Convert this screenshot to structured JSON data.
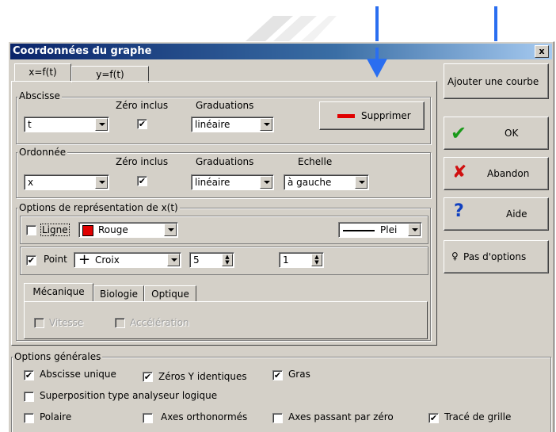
{
  "window": {
    "title": "Coordonnées du graphe",
    "close": "x"
  },
  "tabs": [
    "x=f(t)",
    "y=f(t)"
  ],
  "abscisse": {
    "label": "Abscisse",
    "zero_label": "Zéro inclus",
    "grad_label": "Graduations",
    "variable": "t",
    "graduation": "linéaire",
    "zero_checked": "✔"
  },
  "ordonnee": {
    "label": "Ordonnée",
    "zero_label": "Zéro inclus",
    "grad_label": "Graduations",
    "scale_label": "Echelle",
    "variable": "x",
    "graduation": "linéaire",
    "scale": "à gauche",
    "zero_checked": "✔"
  },
  "supprimer": {
    "label": "Supprimer",
    "accent": "#e00000"
  },
  "options_repr": {
    "label": "Options de représentation de x(t)",
    "ligne": {
      "label": "Ligne",
      "color_name": "Rouge",
      "color": "#e00000",
      "style": "Plei"
    },
    "point": {
      "label": "Point",
      "checked": "✔",
      "shape": "Croix",
      "shape_glyph": "+",
      "size": "5",
      "width": "1"
    },
    "subtabs": [
      "Mécanique",
      "Biologie",
      "Optique"
    ],
    "vitesse": "Vitesse",
    "acceleration": "Accélération"
  },
  "right_buttons": {
    "ajouter": "Ajouter une courbe",
    "ok": "OK",
    "abandon": "Abandon",
    "aide": "Aide",
    "pas_options": "Pas d'options"
  },
  "options_generales": {
    "label": "Options générales",
    "abscisse_unique": "Abscisse unique",
    "zeros_y": "Zéros Y identiques",
    "gras": "Gras",
    "superposition": "Superposition type analyseur logique",
    "polaire": "Polaire",
    "axes_ortho": "Axes orthonormés",
    "axes_zero": "Axes passant par zéro",
    "trace_grille": "Tracé de grille",
    "check": "✔"
  },
  "colors": {
    "titlebar": "#0a246a",
    "annotation_arrow": "#2a6ef0",
    "ok_check": "#1a9a1a",
    "abandon_x": "#d01010",
    "help": "#1040c0"
  }
}
